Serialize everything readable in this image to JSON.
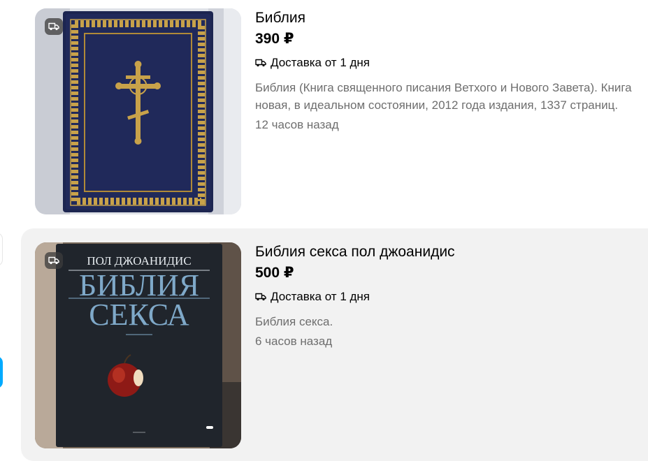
{
  "listings": [
    {
      "title": "Библия",
      "price": "390 ₽",
      "delivery": "Доставка от 1 дня",
      "description": "Библия (Книга священного писания Ветхого и Нового Завета). Книга новая, в идеальном состоянии, 2012 года издания, 1337 страниц.",
      "time": "12 часов назад",
      "photo": {
        "cover_color": "#1c2550",
        "ornament_color": "#c8a24a"
      }
    },
    {
      "title": "Библия секса пол джоанидис",
      "price": "500 ₽",
      "delivery": "Доставка от 1 дня",
      "description": "Библия секса.",
      "time": "6 часов назад",
      "photo": {
        "author": "ПОЛ ДЖОАНИДИС",
        "book_title_1": "БИБЛИЯ",
        "book_title_2": "СЕКСА",
        "cover_color": "#20252c",
        "title_color": "#7fa9c9"
      }
    }
  ],
  "colors": {
    "text": "#000000",
    "muted": "#6e6e6e",
    "highlight_bg": "#f2f2f2",
    "accent": "#00aaff"
  }
}
